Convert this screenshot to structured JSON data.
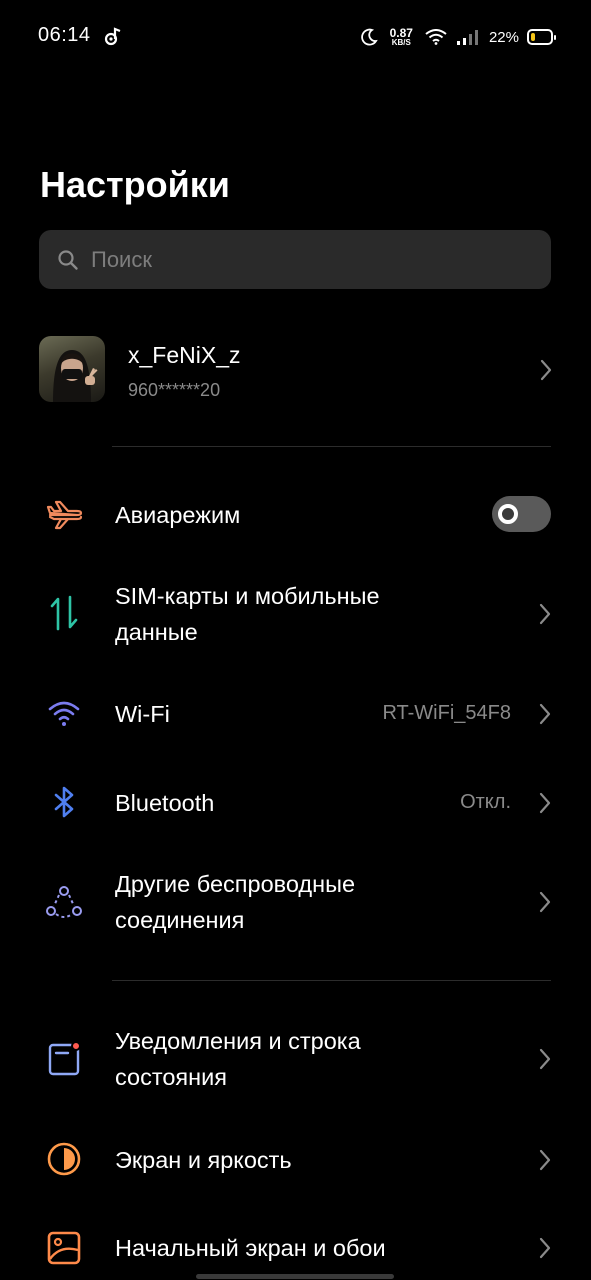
{
  "status_bar": {
    "time": "06:14",
    "net_speed_value": "0.87",
    "net_speed_unit": "KB/S",
    "battery_percent": "22%",
    "battery_level": 0.22,
    "colors": {
      "battery_fill": "#f5c518"
    }
  },
  "page": {
    "title": "Настройки"
  },
  "search": {
    "placeholder": "Поиск"
  },
  "account": {
    "name": "x_FeNiX_z",
    "phone": "960******20"
  },
  "items": [
    {
      "label": "Авиарежим",
      "icon": "airplane-icon",
      "toggle": false
    },
    {
      "label": "SIM-карты и мобильные данные",
      "icon": "sim-data-icon"
    },
    {
      "label": "Wi-Fi",
      "value": "RT-WiFi_54F8",
      "icon": "wifi-icon"
    },
    {
      "label": "Bluetooth",
      "value": "Откл.",
      "icon": "bluetooth-icon"
    },
    {
      "label": "Другие беспроводные соединения",
      "icon": "connections-icon"
    },
    {
      "label": "Уведомления и строка состояния",
      "icon": "notifications-icon"
    },
    {
      "label": "Экран и яркость",
      "icon": "display-brightness-icon"
    },
    {
      "label": "Начальный экран и обои",
      "icon": "wallpaper-icon"
    }
  ],
  "colors": {
    "airplane": "#f08a5d",
    "sim": "#2ec4a6",
    "wifi": "#7b7cf0",
    "bluetooth": "#4f7ff0",
    "connections": "#9a9cf0",
    "notifications": "#8fa8f5",
    "notification_dot": "#ff5a4f",
    "display": "#ff9a4a",
    "wallpaper": "#ff8a4a"
  }
}
